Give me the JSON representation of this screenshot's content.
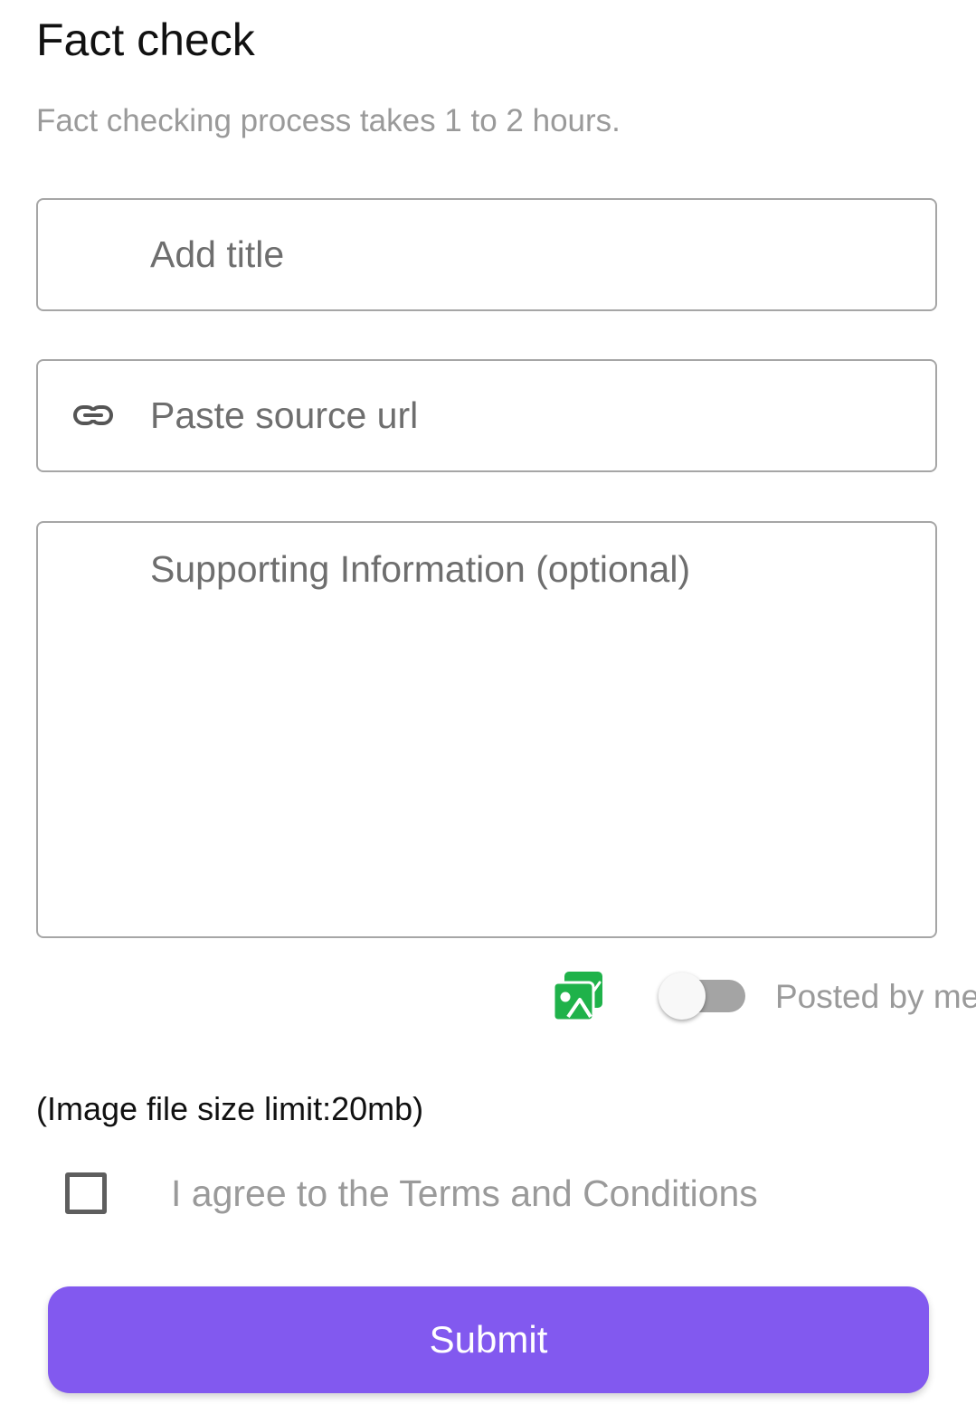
{
  "header": {
    "title": "Fact check",
    "subtitle": "Fact checking process takes 1 to 2 hours."
  },
  "form": {
    "title_placeholder": "Add title",
    "url_placeholder": "Paste source url",
    "info_placeholder": "Supporting Information (optional)",
    "url_icon": "link-icon",
    "image_icon": "image-gallery-icon",
    "toggle_label": "Posted by me",
    "toggle_on": false,
    "size_limit_note": "(Image file size limit:20mb)",
    "terms_label": "I agree to the Terms and Conditions",
    "terms_checked": false,
    "submit_label": "Submit"
  },
  "colors": {
    "accent": "#8259ef",
    "image_icon": "#1fb24a",
    "muted_text": "#9a9a9a",
    "border": "#a6a6a6"
  }
}
